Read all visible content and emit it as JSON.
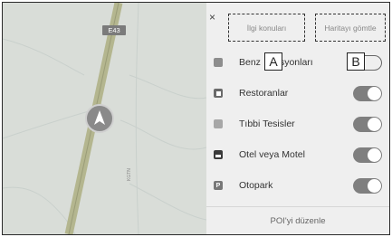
{
  "map": {
    "road_label": "E43",
    "street_label": "KGTN"
  },
  "panel": {
    "close_label": "×",
    "tab_poi": "İlgi konuları",
    "tab_map": "Haritayı gömtle",
    "callout_a": "A",
    "callout_b": "B",
    "items": [
      {
        "label": "Benz",
        "label_suffix": "syonları",
        "icon": "fuel-icon",
        "toggle_on": true
      },
      {
        "label": "Restoranlar",
        "icon": "restaurant-icon",
        "toggle_on": true
      },
      {
        "label": "Tıbbi Tesisler",
        "icon": "medical-icon",
        "toggle_on": true
      },
      {
        "label": "Otel veya Motel",
        "icon": "hotel-icon",
        "toggle_on": true
      },
      {
        "label": "Otopark",
        "icon": "parking-icon",
        "icon_text": "P",
        "toggle_on": true
      }
    ],
    "footer_label": "POI'yi düzenle"
  },
  "colors": {
    "toggle": "#7f7f7f",
    "map_bg": "#d9ddd8",
    "road": "#b4b68f",
    "vehicle": "#8a8a8a"
  }
}
